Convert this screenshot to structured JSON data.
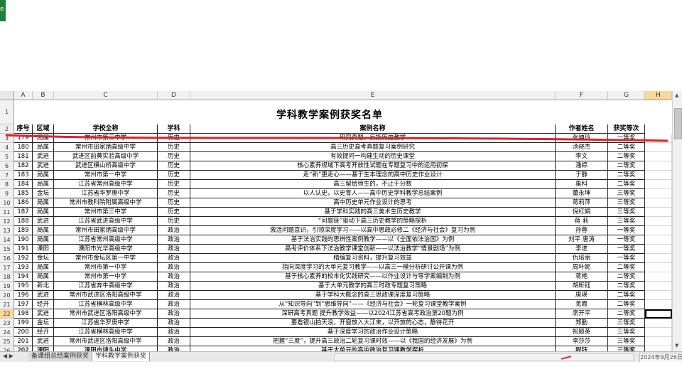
{
  "app": {
    "icon_text": "e"
  },
  "sheet": {
    "columns": [
      "A",
      "B",
      "C",
      "D",
      "E",
      "F",
      "G",
      "H"
    ],
    "title": "学科教学案例获奖名单",
    "headers": [
      "序号",
      "区域",
      "学校全称",
      "学科",
      "案例名称",
      "作者姓名",
      "获奖等次"
    ],
    "row_numbers": [
      "1",
      "2",
      "3",
      "4",
      "5",
      "6",
      "7",
      "8",
      "9",
      "10",
      "11",
      "12",
      "13",
      "14",
      "15",
      "16",
      "17",
      "18",
      "19",
      "20",
      "21",
      "22",
      "23",
      "24",
      "25",
      "26"
    ],
    "rows": [
      [
        "179",
        "局属",
        "常州市第三中学",
        "历史",
        "研究真题，反拨历史教学",
        "张坤玲",
        "一等奖"
      ],
      [
        "180",
        "局属",
        "常州市田家炳高级中学",
        "历史",
        "高三历史高考真题复习案例研究",
        "汤晓杰",
        "二等奖"
      ],
      [
        "181",
        "武进",
        "武进区前黄实验高级中学",
        "历史",
        "有效提问一构建生动的历史课堂",
        "李文",
        "二等奖"
      ],
      [
        "182",
        "武进",
        "武进区横山桥高级中学",
        "历史",
        "核心素养视域下高考开放性试题在专题复习中的运用初探",
        "潘婷",
        "二等奖"
      ],
      [
        "183",
        "局属",
        "常州市第一中学",
        "历史",
        "走“新”更走心——基于生本理念的高中历史作业设计",
        "于静",
        "二等奖"
      ],
      [
        "184",
        "局属",
        "江苏省常州高级中学",
        "历史",
        "高三留给师生的，不止于分数",
        "巢科",
        "二等奖"
      ],
      [
        "185",
        "金坛",
        "江苏省华罗庚中学",
        "历史",
        "以人认史，以史育人——高中历史学科教学总结案例",
        "董永坤",
        "三等奖"
      ],
      [
        "186",
        "局属",
        "常州市教科院附属高级中学",
        "历史",
        "高中历史单元作业设计的思考",
        "蒋莉萍",
        "三等奖"
      ],
      [
        "187",
        "局属",
        "常州市第三中学",
        "历史",
        "基于学科实践的高三美术生历史教学",
        "倪红娟",
        "三等奖"
      ],
      [
        "188",
        "武进",
        "江苏省武进高级中学",
        "历史",
        "“问题链”驱动下高三历史教学的策略探析",
        "蒋 莉",
        "三等奖"
      ],
      [
        "189",
        "局属",
        "常州市田家炳高级中学",
        "政治",
        "激活问题意识，引领深度学习——以高中思政必修二《经济与社会》复习为例",
        "孙蓉",
        "一等奖"
      ],
      [
        "190",
        "局属",
        "江苏省常州高级中学",
        "政治",
        "基于法治实践的思辨性案例教学——以《全面依法治国》为例",
        "刘平 唐涛",
        "一等奖"
      ],
      [
        "191",
        "溧阳",
        "溧阳市光华高级中学",
        "政治",
        "高考评价体系下法治教学课堂创新——以法治教学“情景剧场”为例",
        "李进",
        "一等奖"
      ],
      [
        "192",
        "金坛",
        "常州市金坛区第一中学",
        "政治",
        "精编复习资料，提升复习效益",
        "仇培丽",
        "一等奖"
      ],
      [
        "193",
        "局属",
        "常州市第一中学",
        "政治",
        "指向深度学习的大单元复习教学——以高三一模分析研讨公开课为例",
        "周叶妮",
        "二等奖"
      ],
      [
        "194",
        "局属",
        "常州市第一中学",
        "政治",
        "基于核心素养的校本化实践研究——以作业设计与导学案编制为例",
        "蒋艳",
        "二等奖"
      ],
      [
        "195",
        "新北",
        "江苏省奔牛高级中学",
        "政治",
        "基于大单元教学的高三时政专题复习策略",
        "胡昕钰",
        "二等奖"
      ],
      [
        "196",
        "武进",
        "常州市武进区洛阳高级中学",
        "政治",
        "基于学科大概念的高三思政课深度复习策略",
        "唐瑛",
        "二等奖"
      ],
      [
        "197",
        "经开",
        "江苏省横林高级中学",
        "政治",
        "从“知识导向”到“思维导向”——《经济与社会》一轮复习课堂教学案例",
        "羌霞",
        "二等奖"
      ],
      [
        "198",
        "武进",
        "常州市武进区洛阳高级中学",
        "政治",
        "深研高考真题 提升教学效益——以2024江苏省高考政治第20题为例",
        "席开平",
        "二等奖"
      ],
      [
        "199",
        "金坛",
        "江苏省华罗庚中学",
        "政治",
        "要看银山拍天浪，开窗放入大江来，以开放的心态，静待花开",
        "郑勤",
        "三等奖"
      ],
      [
        "200",
        "经开",
        "江苏省横林高级中学",
        "政治",
        "基于深度学习的政治作业设计策略",
        "祝颖英",
        "三等奖"
      ],
      [
        "201",
        "武进",
        "常州市武进区洛阳高级中学",
        "政治",
        "把握“三度”，提升高三政治二轮复习课时效——以《我国的经济发展》为例",
        "李莎莎",
        "三等奖"
      ],
      [
        "202",
        "溧阳",
        "溧阳市埭头中学",
        "政治",
        "基于大单元的高中政治复习课教学探析",
        "程钰",
        "三等奖"
      ]
    ]
  },
  "tabs": {
    "items": [
      "备课组总结案例获奖",
      "学科教学案例获奖"
    ],
    "active_index": 1,
    "nav_arrows": "◀ ▶"
  },
  "status": {
    "date": "2024年9月26日"
  },
  "colors": {
    "annotation_red": "#d9232d",
    "selection_header": "#f9d99a"
  }
}
